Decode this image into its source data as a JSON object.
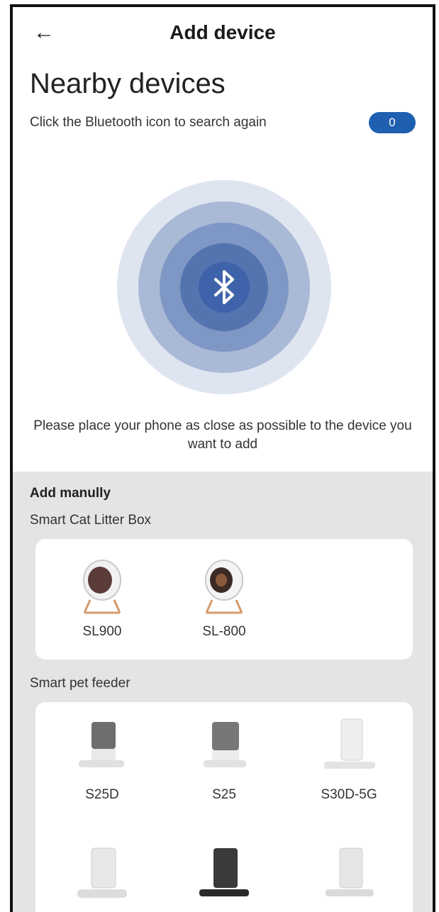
{
  "header": {
    "title": "Add device",
    "back_icon": "arrow-left-icon"
  },
  "nearby": {
    "title": "Nearby devices",
    "subtitle": "Click the Bluetooth icon to search again",
    "found_count": "0",
    "bluetooth_icon": "bluetooth-icon",
    "hint": "Please place your phone as close as possible to the device you want to add"
  },
  "manual": {
    "heading": "Add manully",
    "categories": [
      {
        "label": "Smart Cat Litter Box",
        "devices": [
          {
            "name": "SL900"
          },
          {
            "name": "SL-800"
          }
        ]
      },
      {
        "label": "Smart pet feeder",
        "devices": [
          {
            "name": "S25D"
          },
          {
            "name": "S25"
          },
          {
            "name": "S30D-5G"
          },
          {
            "name": ""
          },
          {
            "name": ""
          },
          {
            "name": ""
          }
        ]
      }
    ]
  },
  "colors": {
    "accent": "#1f5fb0",
    "ring_outer": "#dfe5f0",
    "ring_2": "#a9b9d6",
    "ring_3": "#7f97c4",
    "ring_4": "#5474b0",
    "ring_core": "#3f63aa",
    "manual_bg": "#e5e3e3"
  }
}
